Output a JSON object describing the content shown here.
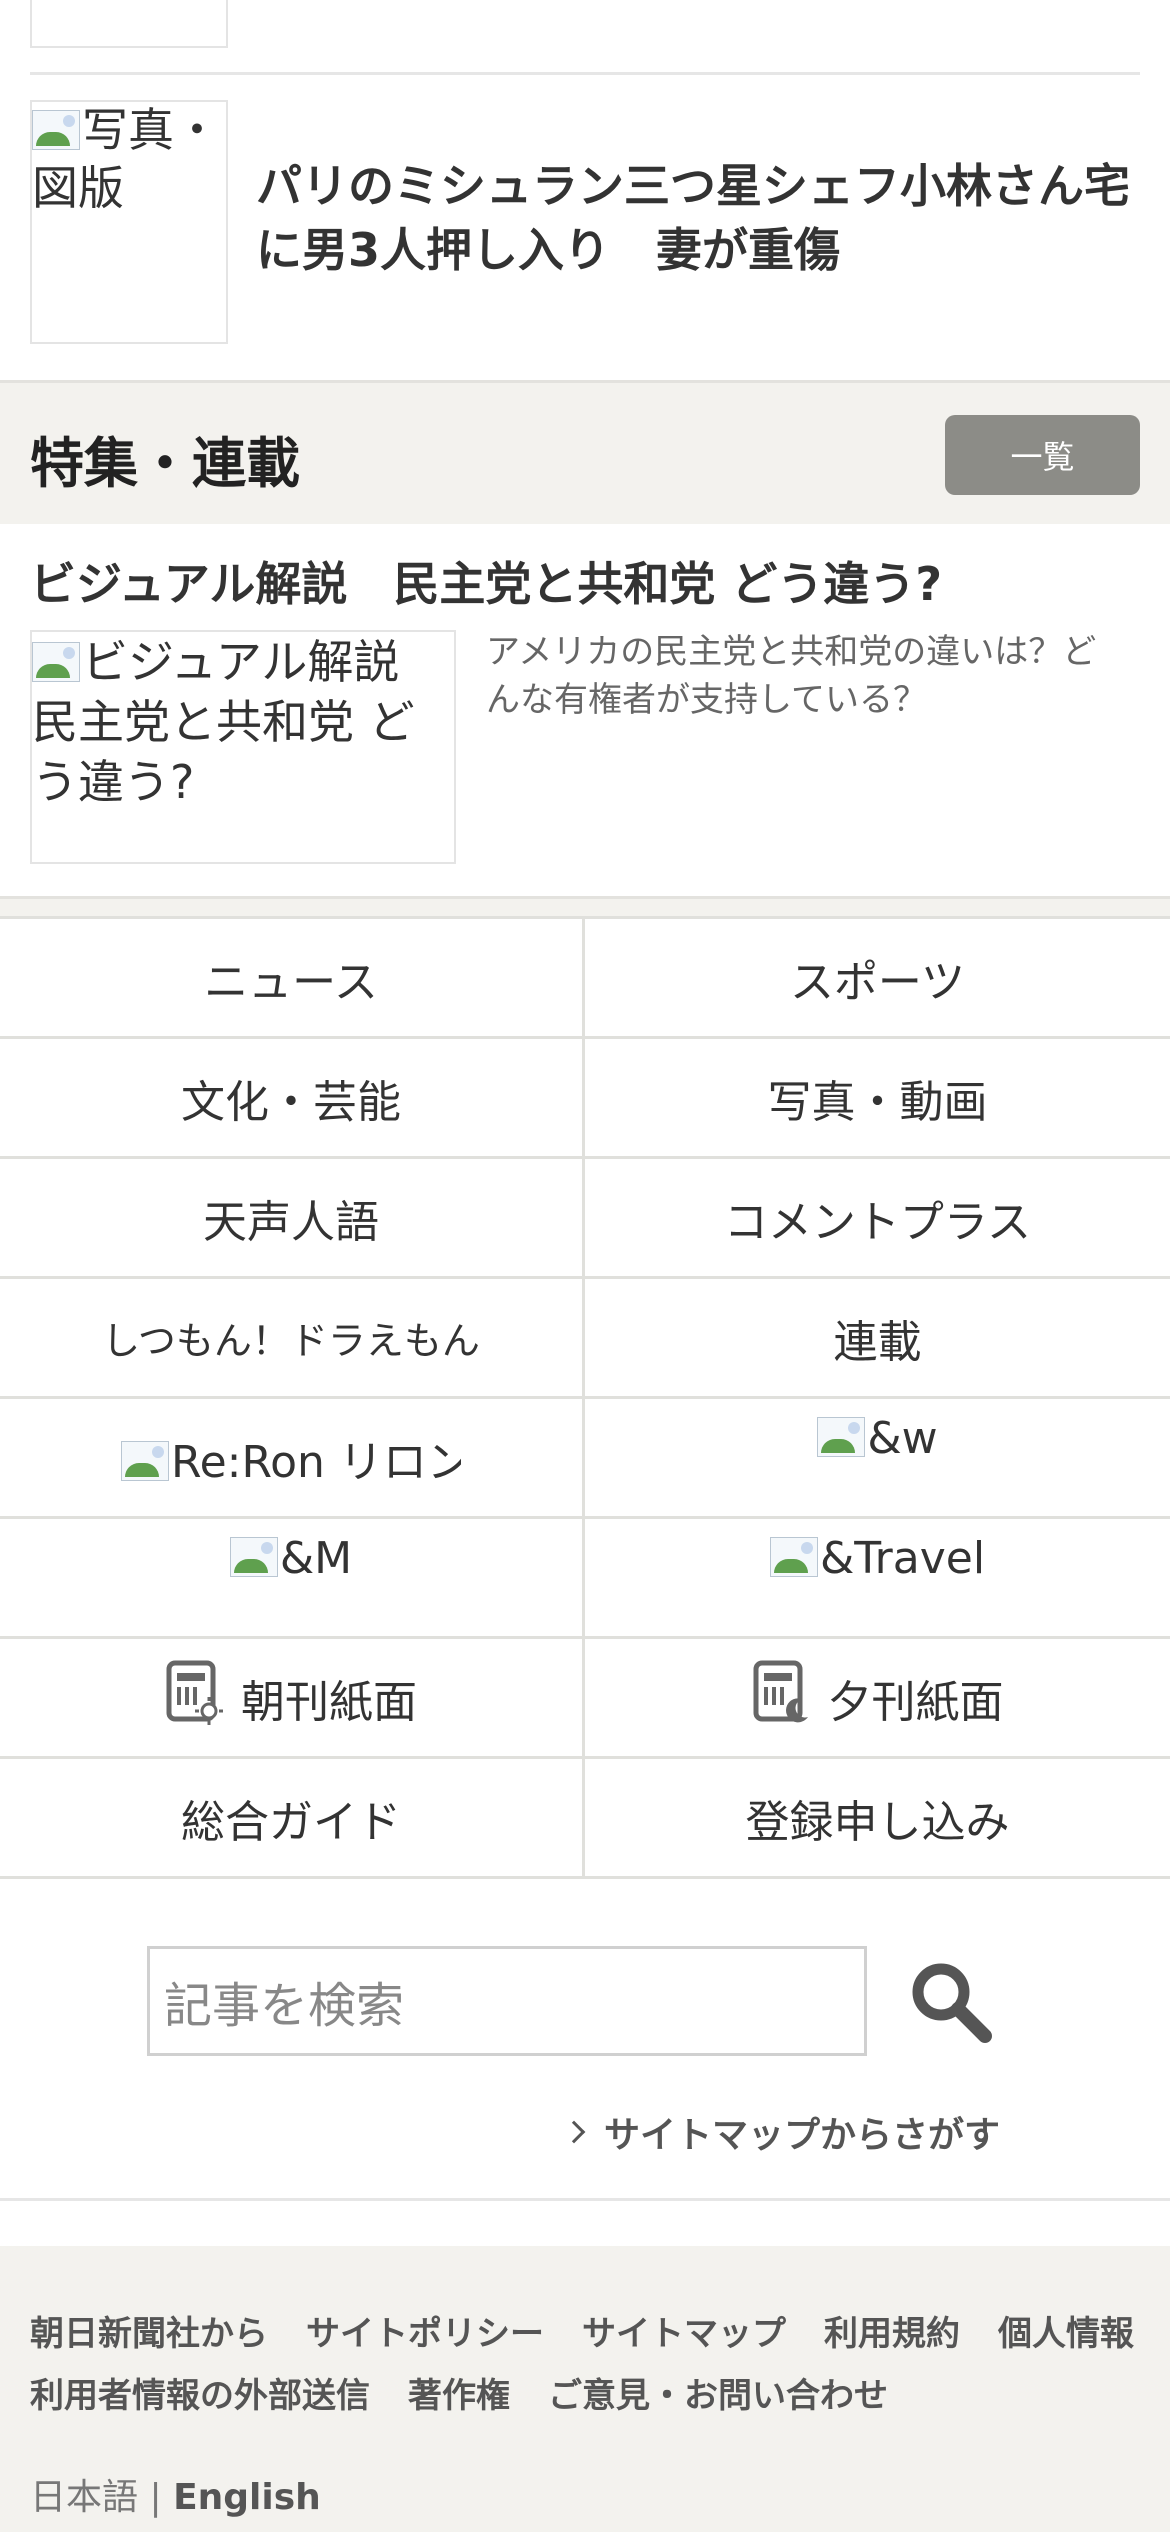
{
  "prev_article": {
    "image_alt": ""
  },
  "article": {
    "image_alt": "写真・図版",
    "headline": "パリのミシュラン三つ星シェフ小林さん宅に男3人押し入り　妻が重傷"
  },
  "special": {
    "title": "特集・連載",
    "list_button": "一覧",
    "feature_title": "ビジュアル解説　民主党と共和党 どう違う?",
    "feature_image_alt": "ビジュアル解説　民主党と共和党 どう違う?",
    "feature_desc": "アメリカの民主党と共和党の違いは？どんな有権者が支持している？"
  },
  "nav": {
    "news": "ニュース",
    "sports": "スポーツ",
    "culture": "文化・芸能",
    "photo_video": "写真・動画",
    "tensei": "天声人語",
    "comment_plus": "コメントプラス",
    "doraemon": "しつもん！ドラえもん",
    "series": "連載",
    "reron": "Re:Ron リロン",
    "andw": "&w",
    "andm": "&M",
    "andtravel": "&Travel",
    "morning": "朝刊紙面",
    "evening": "夕刊紙面",
    "guide": "総合ガイド",
    "register": "登録申し込み"
  },
  "search": {
    "placeholder": "記事を検索",
    "sitemap_link": "サイトマップからさがす"
  },
  "footer": {
    "links_row1": [
      "朝日新聞社から",
      "サイトポリシー",
      "サイトマップ",
      "利用規約",
      "個人情報"
    ],
    "links_row2": [
      "利用者情報の外部送信",
      "著作権",
      "ご意見・お問い合わせ"
    ],
    "lang_ja": "日本語",
    "lang_sep": "|",
    "lang_en": "English"
  },
  "colors": {
    "band_bg": "#f3f2ee",
    "button_bg": "#8c8c87",
    "divider": "#e0e0dc"
  }
}
